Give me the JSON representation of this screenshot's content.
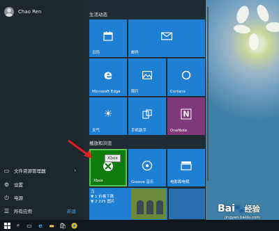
{
  "user": {
    "name": "Chao Ren"
  },
  "left_menu": [
    {
      "label": "文件资源管理器",
      "icon": "folder-icon",
      "has_arrow": true
    },
    {
      "label": "设置",
      "icon": "gear-icon",
      "has_arrow": false
    },
    {
      "label": "电源",
      "icon": "power-icon",
      "has_arrow": false
    },
    {
      "label": "所有应用",
      "icon": "list-icon",
      "badge": "新建"
    }
  ],
  "sections": {
    "life": "生活动态",
    "play": "播放和浏览"
  },
  "tiles": {
    "calendar": "日历",
    "mail": "邮件",
    "edge": "Microsoft Edge",
    "photos": "照片",
    "cortana": "Cortana",
    "weather": "天气",
    "phone": "手机助手",
    "onenote": "OneNote",
    "xbox": "Xbox",
    "groove": "Groove 音乐",
    "movies": "电影和电视"
  },
  "tooltip": "Xbox",
  "store_tile": {
    "line1": "马",
    "line2": "▼ 1 价格下跌",
    "line3": "▼ 2 225 图片"
  },
  "watermark": {
    "brand": "Bai",
    "brand2": "经验",
    "url": "jingyan.baidu.com"
  },
  "colors": {
    "tile_blue": "#1e7fd3",
    "xbox_green": "#107c10",
    "onenote_purple": "#80397b"
  }
}
